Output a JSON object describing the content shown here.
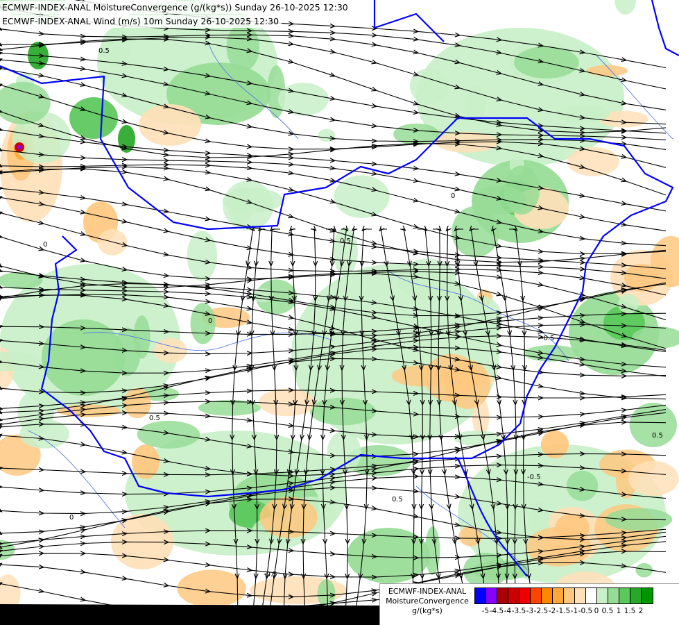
{
  "titles": {
    "line1": "ECMWF-INDEX-ANAL MoistureConvergence (g/(kg*s)) Sunday 26-10-2025 12:30",
    "line2": "ECMWF-INDEX-ANAL Wind (m/s) 10m Sunday 26-10-2025 12:30"
  },
  "map": {
    "contour_labels": [
      "0.5",
      "0",
      "-0.5",
      "0.5",
      "0",
      "0.5",
      "-0.5",
      "0",
      "0.5",
      "0.5",
      "0",
      "-0.5"
    ],
    "colors": {
      "background": "#ffffff",
      "border_color": "#0000ff",
      "river_color": "#5a78e6",
      "streamline_color": "#000000",
      "outside_area": "#000000"
    }
  },
  "legend": {
    "label_line1": "ECMWF-INDEX-ANAL",
    "label_line2": "MoistureConvergence",
    "label_line3": "g/(kg*s)",
    "swatches": [
      "#0000ff",
      "#8800ff",
      "#aa0000",
      "#cc0000",
      "#ee0000",
      "#ff4400",
      "#ff8800",
      "#ffa838",
      "#ffc880",
      "#ffe0b8",
      "#ffffff",
      "#c8f0c8",
      "#96dc96",
      "#5ac85a",
      "#28a828",
      "#009600"
    ],
    "ticks": [
      "-5",
      "-4.5",
      "-4",
      "-3.5",
      "-3",
      "-2.5",
      "-2",
      "-1.5",
      "-1",
      "-0.5",
      "0",
      "0.5",
      "1",
      "1.5",
      "2"
    ]
  }
}
